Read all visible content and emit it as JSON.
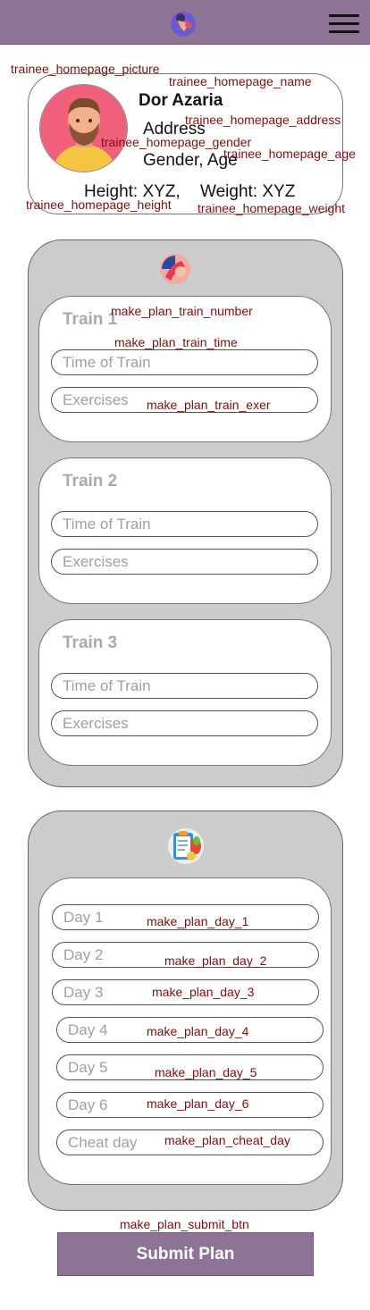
{
  "header": {
    "logo_icon": "trainer-logo-icon",
    "menu_icon": "hamburger-menu-icon"
  },
  "labels": {
    "picture": "trainee_homepage_picture",
    "name": "trainee_homepage_name",
    "address": "trainee_homepage_address",
    "gender": "trainee_homepage_gender",
    "age": "trainee_homepage_age",
    "height": "trainee_homepage_height",
    "weight": "trainee_homepage_weight",
    "train_number": "make_plan_train_number",
    "train_time": "make_plan_train_time",
    "train_exer": "make_plan_train_exer",
    "day_1": "make_plan_day_1",
    "day_2": "make_plan_day_2",
    "day_3": "make_plan_day_3",
    "day_4": "make_plan_day_4",
    "day_5": "make_plan_day_5",
    "day_6": "make_plan_day_6",
    "cheat_day": "make_plan_cheat_day",
    "submit_btn": "make_plan_submit_btn"
  },
  "profile": {
    "name": "Dor Azaria",
    "address": "Address",
    "gender_age": "Gender,  Age",
    "height": "Height: XYZ,",
    "weight": "Weight: XYZ"
  },
  "trains": [
    {
      "title": "Train 1",
      "time_placeholder": "Time of Train",
      "exercises_placeholder": "Exercises"
    },
    {
      "title": "Train 2",
      "time_placeholder": "Time of Train",
      "exercises_placeholder": "Exercises"
    },
    {
      "title": "Train 3",
      "time_placeholder": "Time of Train",
      "exercises_placeholder": "Exercises"
    }
  ],
  "days": [
    {
      "placeholder": "Day 1"
    },
    {
      "placeholder": "Day 2"
    },
    {
      "placeholder": "Day 3"
    },
    {
      "placeholder": "Day 4"
    },
    {
      "placeholder": "Day 5"
    },
    {
      "placeholder": "Day 6"
    },
    {
      "placeholder": "Cheat day"
    }
  ],
  "submit_label": "Submit Plan",
  "colors": {
    "header": "#8d7394",
    "panel": "#cccccc",
    "annotation": "#7a1010"
  }
}
